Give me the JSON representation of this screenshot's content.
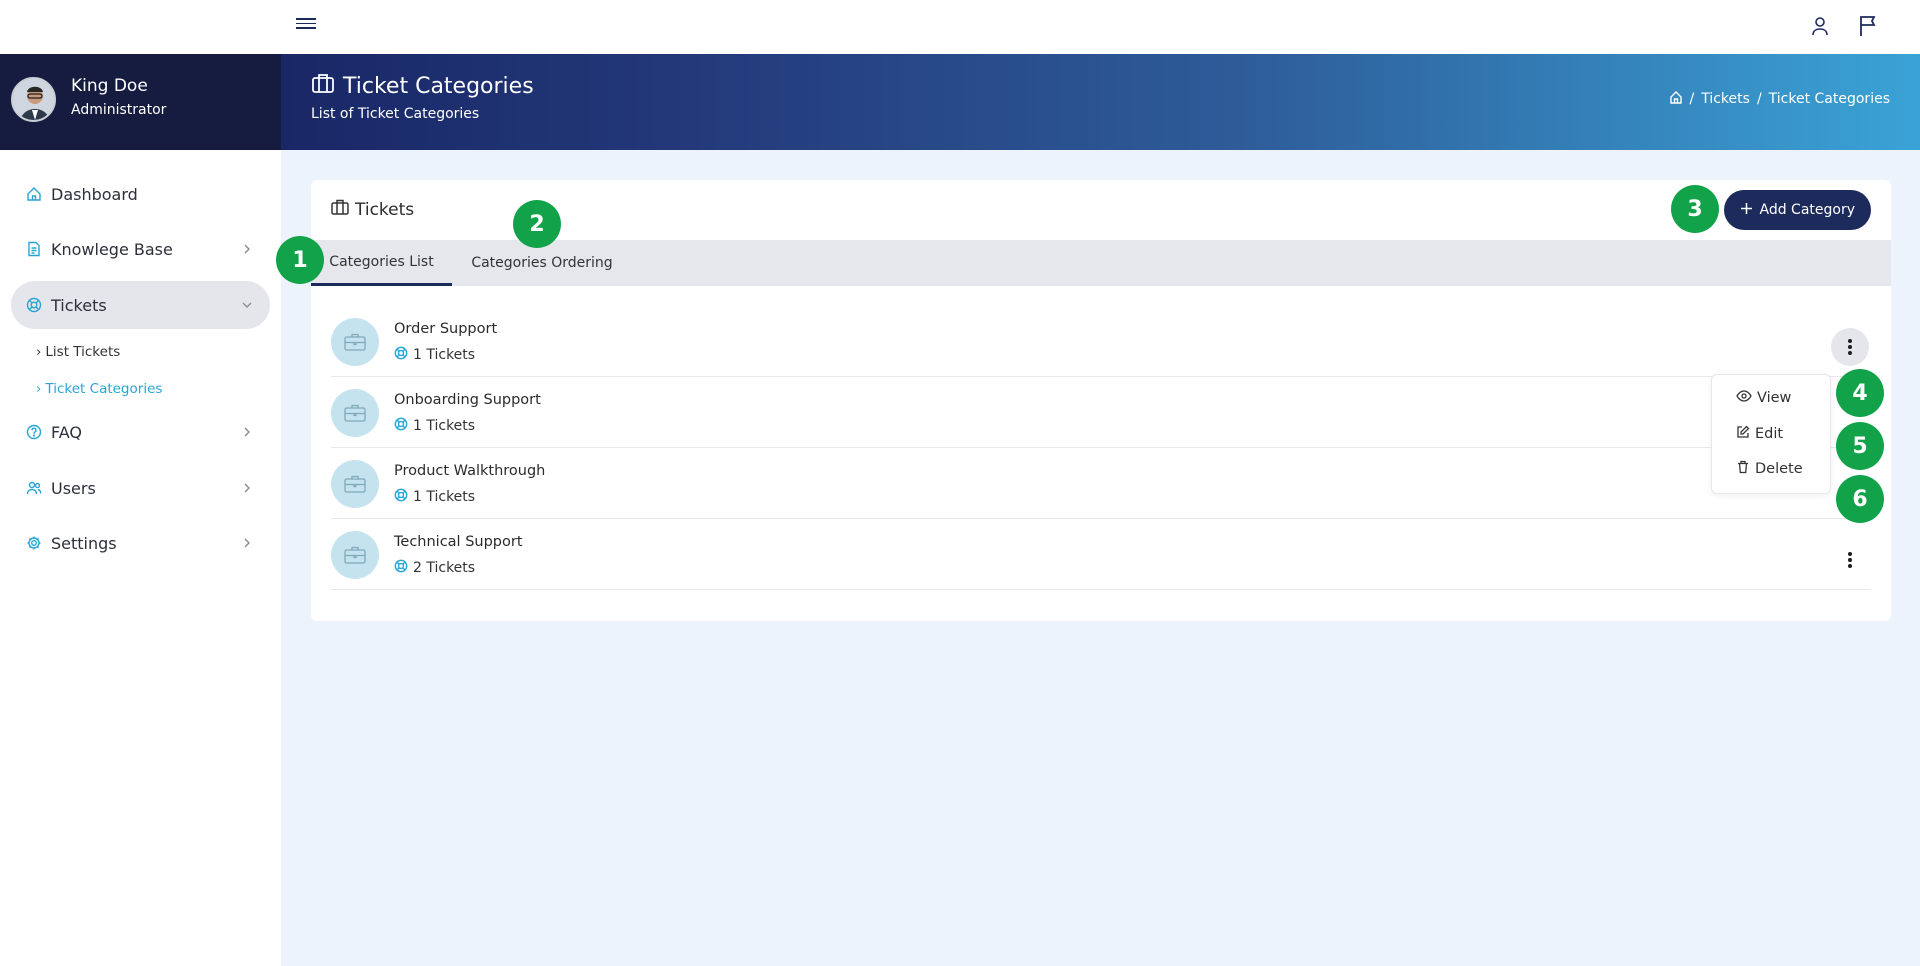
{
  "topbar": {
    "menu_icon": "hamburger-icon",
    "user_icon": "user-icon",
    "flag_icon": "flag-icon"
  },
  "profile": {
    "name": "King Doe",
    "role": "Administrator"
  },
  "banner": {
    "title": "Ticket Categories",
    "subtitle": "List of Ticket Categories",
    "breadcrumb": [
      "Tickets",
      "Ticket Categories"
    ]
  },
  "sidebar": {
    "items": [
      {
        "label": "Dashboard",
        "icon": "home-icon"
      },
      {
        "label": "Knowlege Base",
        "icon": "document-icon"
      },
      {
        "label": "Tickets",
        "icon": "lifebuoy-icon"
      },
      {
        "label": "FAQ",
        "icon": "question-icon"
      },
      {
        "label": "Users",
        "icon": "users-icon"
      },
      {
        "label": "Settings",
        "icon": "gear-icon"
      }
    ],
    "sub_items": [
      "List Tickets",
      "Ticket Categories"
    ]
  },
  "card": {
    "title": "Tickets",
    "add_button": "Add Category",
    "tabs": [
      "Categories List",
      "Categories Ordering"
    ],
    "rows": [
      {
        "name": "Order Support",
        "count": "1 Tickets"
      },
      {
        "name": "Onboarding Support",
        "count": "1 Tickets"
      },
      {
        "name": "Product Walkthrough",
        "count": "1 Tickets"
      },
      {
        "name": "Technical Support",
        "count": "2 Tickets"
      }
    ]
  },
  "dropdown": {
    "items": [
      "View",
      "Edit",
      "Delete"
    ]
  },
  "markers": [
    "1",
    "2",
    "3",
    "4",
    "5",
    "6"
  ],
  "colors": {
    "accent": "#1d2a5c",
    "link": "#27a6d6",
    "marker": "#12a34a"
  }
}
